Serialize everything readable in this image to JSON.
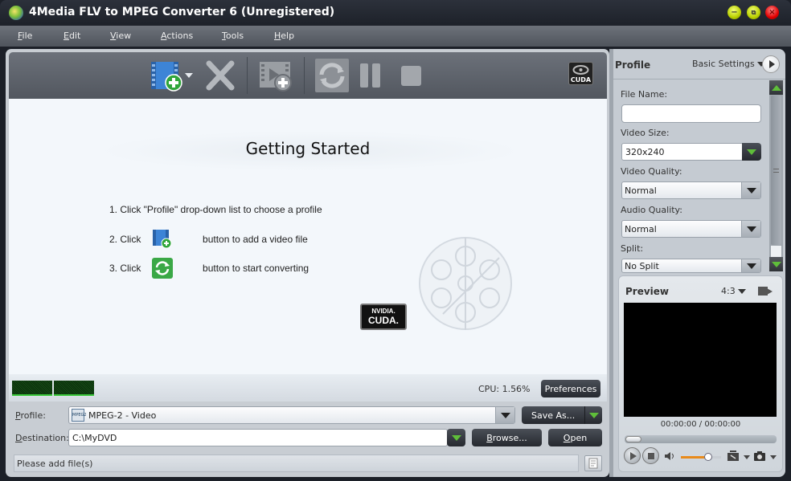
{
  "window": {
    "title": "4Media FLV to MPEG Converter 6 (Unregistered)",
    "controls": {
      "minimize": "minimize-icon",
      "restore": "restore-icon",
      "close": "close-icon"
    }
  },
  "menu": {
    "items": [
      {
        "label": "File",
        "mnemonic": "F",
        "rest": "ile"
      },
      {
        "label": "Edit",
        "mnemonic": "E",
        "rest": "dit"
      },
      {
        "label": "View",
        "mnemonic": "V",
        "rest": "iew"
      },
      {
        "label": "Actions",
        "mnemonic": "A",
        "rest": "ctions"
      },
      {
        "label": "Tools",
        "mnemonic": "T",
        "rest": "ools"
      },
      {
        "label": "Help",
        "mnemonic": "H",
        "rest": "elp"
      }
    ]
  },
  "toolbar": {
    "add_file": "add-video-icon",
    "remove": "remove-icon",
    "add_segment": "add-segment-icon",
    "convert": "convert-icon",
    "pause": "pause-icon",
    "stop": "stop-icon",
    "cuda_badge": "CUDA"
  },
  "getting_started": {
    "title": "Getting Started",
    "step1": "1. Click \"Profile\" drop-down list to choose a profile",
    "step2_prefix": "2. Click",
    "step2_suffix": "button to add a video file",
    "step3_prefix": "3. Click",
    "step3_suffix": "button to start converting",
    "nvidia_brand": "NVIDIA.",
    "cuda_text": "CUDA."
  },
  "status_strip": {
    "cpu": "CPU: 1.56%",
    "preferences": "Preferences"
  },
  "bottom": {
    "profile_label_mn": "P",
    "profile_label_rest": "rofile:",
    "profile_value": "MPEG-2 - Video",
    "profile_icon_text": "MPEG2",
    "save_as": "Save As...",
    "destination_label_mn": "D",
    "destination_label_rest": "estination:",
    "destination_value": "C:\\MyDVD",
    "browse_mn": "B",
    "browse_rest": "rowse...",
    "open_mn": "O",
    "open_rest": "pen",
    "status": "Please add file(s)"
  },
  "side": {
    "title": "Profile",
    "settings_mode": "Basic Settings",
    "file_name_label": "File Name:",
    "file_name_value": "",
    "video_size_label": "Video Size:",
    "video_size_value": "320x240",
    "video_quality_label": "Video Quality:",
    "video_quality_value": "Normal",
    "audio_quality_label": "Audio Quality:",
    "audio_quality_value": "Normal",
    "split_label": "Split:",
    "split_value": "No Split"
  },
  "preview": {
    "title": "Preview",
    "aspect": "4:3",
    "time": "00:00:00 / 00:00:00",
    "volume_level": 0.62,
    "seek_position": 0.0
  }
}
